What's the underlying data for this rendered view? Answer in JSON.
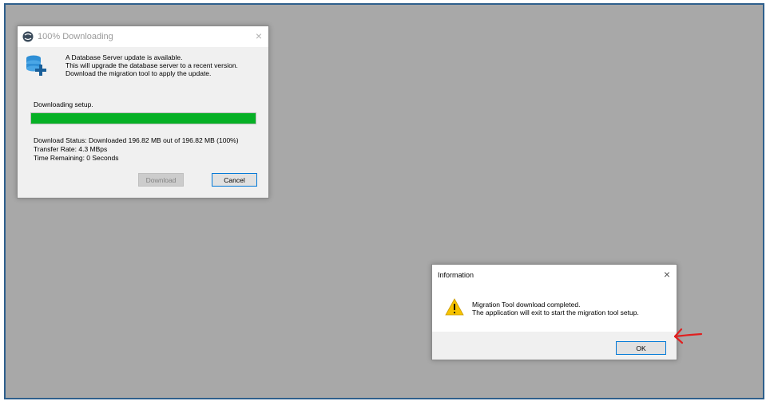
{
  "download_dialog": {
    "title": "100% Downloading",
    "close_glyph": "×",
    "icon": "database-add-icon",
    "message_lines": [
      "A Database Server update is available.",
      "This will upgrade the database server to a recent version.",
      "Download the migration tool to apply the update."
    ],
    "setup_label": "Downloading setup.",
    "progress": 1.0,
    "progress_color": "#06b025",
    "status_lines": [
      "Download Status: Downloaded 196.82 MB out of 196.82 MB (100%)",
      "Transfer Rate: 4.3 MBps",
      "Time Remaining: 0 Seconds"
    ],
    "download_button": "Download",
    "cancel_button": "Cancel"
  },
  "info_dialog": {
    "title": "Information",
    "close_glyph": "×",
    "icon": "warning-icon",
    "message_lines": [
      "Migration Tool download completed.",
      "The application will exit to start the migration tool setup."
    ],
    "ok_button": "OK"
  },
  "annotation": {
    "icon": "red-arrow-icon",
    "color": "#e02020"
  },
  "colors": {
    "desktop": "#a8a8a8",
    "frame_border": "#2e5f8c",
    "focus_border": "#0078d7"
  }
}
